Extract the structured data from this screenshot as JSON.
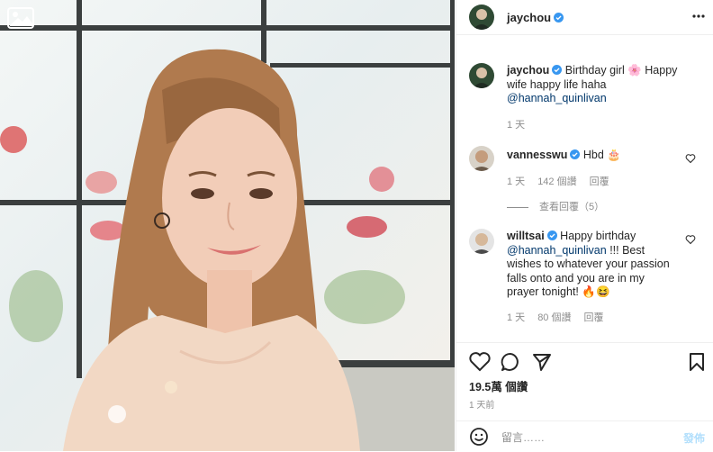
{
  "header": {
    "username": "jaychou",
    "more_icon": "more-horizontal-icon"
  },
  "caption": {
    "username": "jaychou",
    "text_1": "Birthday girl",
    "emoji_1": "🌸",
    "text_2": "Happy wife happy life haha",
    "mention": "@hannah_quinlivan",
    "time": "1 天"
  },
  "comments": [
    {
      "username": "vannesswu",
      "text": "Hbd",
      "emoji": "🎂",
      "time": "1 天",
      "likes": "142 個讚",
      "reply": "回覆",
      "view_replies": "查看回覆（5）"
    },
    {
      "username": "willtsai",
      "text_1": "Happy birthday",
      "mention": "@hannah_quinlivan",
      "text_2": "!!! Best wishes to whatever your passion falls onto and you are in my prayer tonight!",
      "emoji": "🔥😆",
      "time": "1 天",
      "likes": "80 個讚",
      "reply": "回覆"
    }
  ],
  "actions": {
    "likes": "19.5萬 個讚",
    "time": "1 天前"
  },
  "comment_input": {
    "placeholder": "留言……",
    "post_label": "發佈"
  },
  "colors": {
    "verified": "#3897f0",
    "link": "#00376b",
    "muted": "#8e8e8e"
  }
}
